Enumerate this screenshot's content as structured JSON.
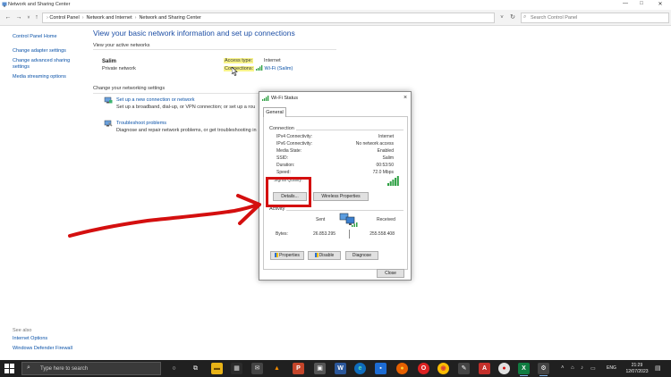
{
  "window": {
    "title": "Network and Sharing Center",
    "controls": {
      "minimize": "—",
      "maximize": "□",
      "close": "✕"
    }
  },
  "address_bar": {
    "crumbs": [
      "Control Panel",
      "Network and Internet",
      "Network and Sharing Center"
    ],
    "search_placeholder": "Search Control Panel"
  },
  "sidebar": {
    "links": [
      "Control Panel Home",
      "Change adapter settings",
      "Change advanced sharing",
      "settings",
      "Media streaming options"
    ],
    "see_also_label": "See also",
    "see_also_links": [
      "Internet Options",
      "Windows Defender Firewall"
    ]
  },
  "main": {
    "title": "View your basic network information and set up connections",
    "active_networks_heading": "View your active networks",
    "network": {
      "name": "Salim",
      "type": "Private network",
      "access_type_label": "Access type:",
      "access_type_value": "Internet",
      "connections_label": "Connections:",
      "connections_link": "Wi-Fi (Salim)"
    },
    "change_settings_heading": "Change your networking settings",
    "tasks": [
      {
        "link": "Set up a new connection or network",
        "desc": "Set up a broadband, dial-up, or VPN connection; or set up a rou"
      },
      {
        "link": "Troubleshoot problems",
        "desc": "Diagnose and repair network problems, or get troubleshooting in"
      }
    ]
  },
  "dialog": {
    "title": "Wi-Fi Status",
    "tab": "General",
    "connection_group": "Connection",
    "rows": [
      {
        "key": "IPv4 Connectivity:",
        "value": "Internet"
      },
      {
        "key": "IPv6 Connectivity:",
        "value": "No network access"
      },
      {
        "key": "Media State:",
        "value": "Enabled"
      },
      {
        "key": "SSID:",
        "value": "Salim"
      },
      {
        "key": "Duration:",
        "value": "00:53:50"
      },
      {
        "key": "Speed:",
        "value": "72.0 Mbps"
      }
    ],
    "signal_quality_label": "Signal Quality:",
    "details_button": "Details...",
    "wireless_properties_button": "Wireless Properties",
    "activity_group": "Activity",
    "sent_label": "Sent",
    "received_label": "Received",
    "bytes_label": "Bytes:",
    "bytes_sent": "26.853.295",
    "bytes_received": "255.558.408",
    "properties_button": "Properties",
    "disable_button": "Disable",
    "diagnose_button": "Diagnose",
    "close_button": "Close"
  },
  "taskbar": {
    "search_placeholder": "Type here to search",
    "language": "ENG",
    "time": "21:29",
    "date": "12/07/2023"
  },
  "colors": {
    "link_blue": "#0a52a8",
    "title_blue": "#1e4fa5",
    "highlight_yellow": "#f8f48a",
    "annotation_red": "#d40f0f",
    "taskbar_bg": "#202020"
  }
}
